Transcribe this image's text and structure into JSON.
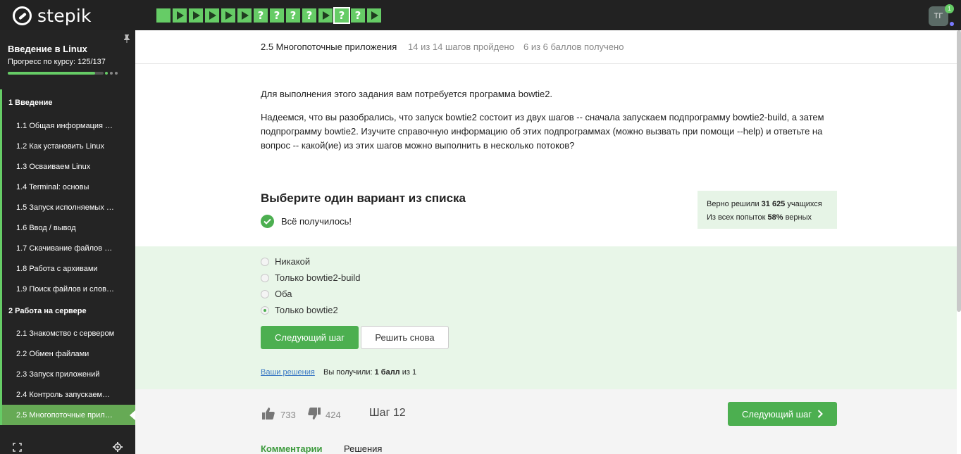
{
  "header": {
    "logo_text": "stepik",
    "steps": [
      "done",
      "play",
      "play",
      "play",
      "play",
      "play",
      "q",
      "q",
      "q",
      "q",
      "play",
      "q-active",
      "q",
      "play"
    ],
    "step_glyph": "?",
    "avatar_initials": "ТГ",
    "notification_count": "1"
  },
  "sidebar": {
    "course_title": "Введение в Linux",
    "progress_label": "Прогресс по курсу:  125/137",
    "progress_fraction": 0.912,
    "sections": [
      {
        "label": "1  Введение",
        "items": [
          "1.1  Общая информация о …",
          "1.2  Как установить Linux",
          "1.3  Осваиваем Linux",
          "1.4  Terminal: основы",
          "1.5  Запуск исполняемых ф…",
          "1.6  Ввод / вывод",
          "1.7  Скачивание файлов из…",
          "1.8  Работа с архивами",
          "1.9  Поиск файлов и слов в…"
        ]
      },
      {
        "label": "2  Работа на сервере",
        "items": [
          "2.1  Знакомство с сервером",
          "2.2  Обмен файлами",
          "2.3  Запуск приложений",
          "2.4  Контроль запускаемых…",
          "2.5  Многопоточные прило…"
        ]
      }
    ]
  },
  "lesson": {
    "title": "2.5 Многопоточные приложения",
    "steps_done": "14 из 14 шагов пройдено",
    "score": "6 из 6 баллов  получено"
  },
  "task": {
    "p1": "Для выполнения этого задания вам потребуется программа bowtie2.",
    "p2": "Надеемся, что вы разобрались, что запуск bowtie2 состоит из двух шагов -- сначала запускаем подпрограмму bowtie2-build, а затем подпрограмму bowtie2. Изучите справочную информацию об этих подпрограммах (можно вызвать при помощи --help) и ответьте на вопрос -- какой(ие) из этих шагов можно выполнить в несколько потоков?"
  },
  "quiz": {
    "title": "Выберите один вариант из списка",
    "success": "Всё получилось!",
    "stats_line1_prefix": "Верно решили ",
    "stats_line1_value": "31 625",
    "stats_line1_suffix": " учащихся",
    "stats_line2_prefix": "Из всех попыток ",
    "stats_line2_value": "58%",
    "stats_line2_suffix": " верных",
    "options": [
      "Никакой",
      "Только bowtie2-build",
      "Оба",
      "Только bowtie2"
    ],
    "selected_index": 3,
    "next_button": "Следующий шаг",
    "retry_button": "Решить снова",
    "your_solutions": "Ваши решения",
    "received_prefix": "Вы получили: ",
    "received_value": "1 балл",
    "received_suffix": " из 1"
  },
  "footer": {
    "likes": "733",
    "dislikes": "424",
    "step_label": "Шаг 12",
    "next_button": "Следующий шаг",
    "tab_comments": "Комментарии",
    "tab_solutions": "Решения"
  },
  "colors": {
    "accent": "#4caf50",
    "step_green": "#66cc66",
    "dark_bg": "#222222",
    "answer_bg": "#e8f6e8"
  }
}
